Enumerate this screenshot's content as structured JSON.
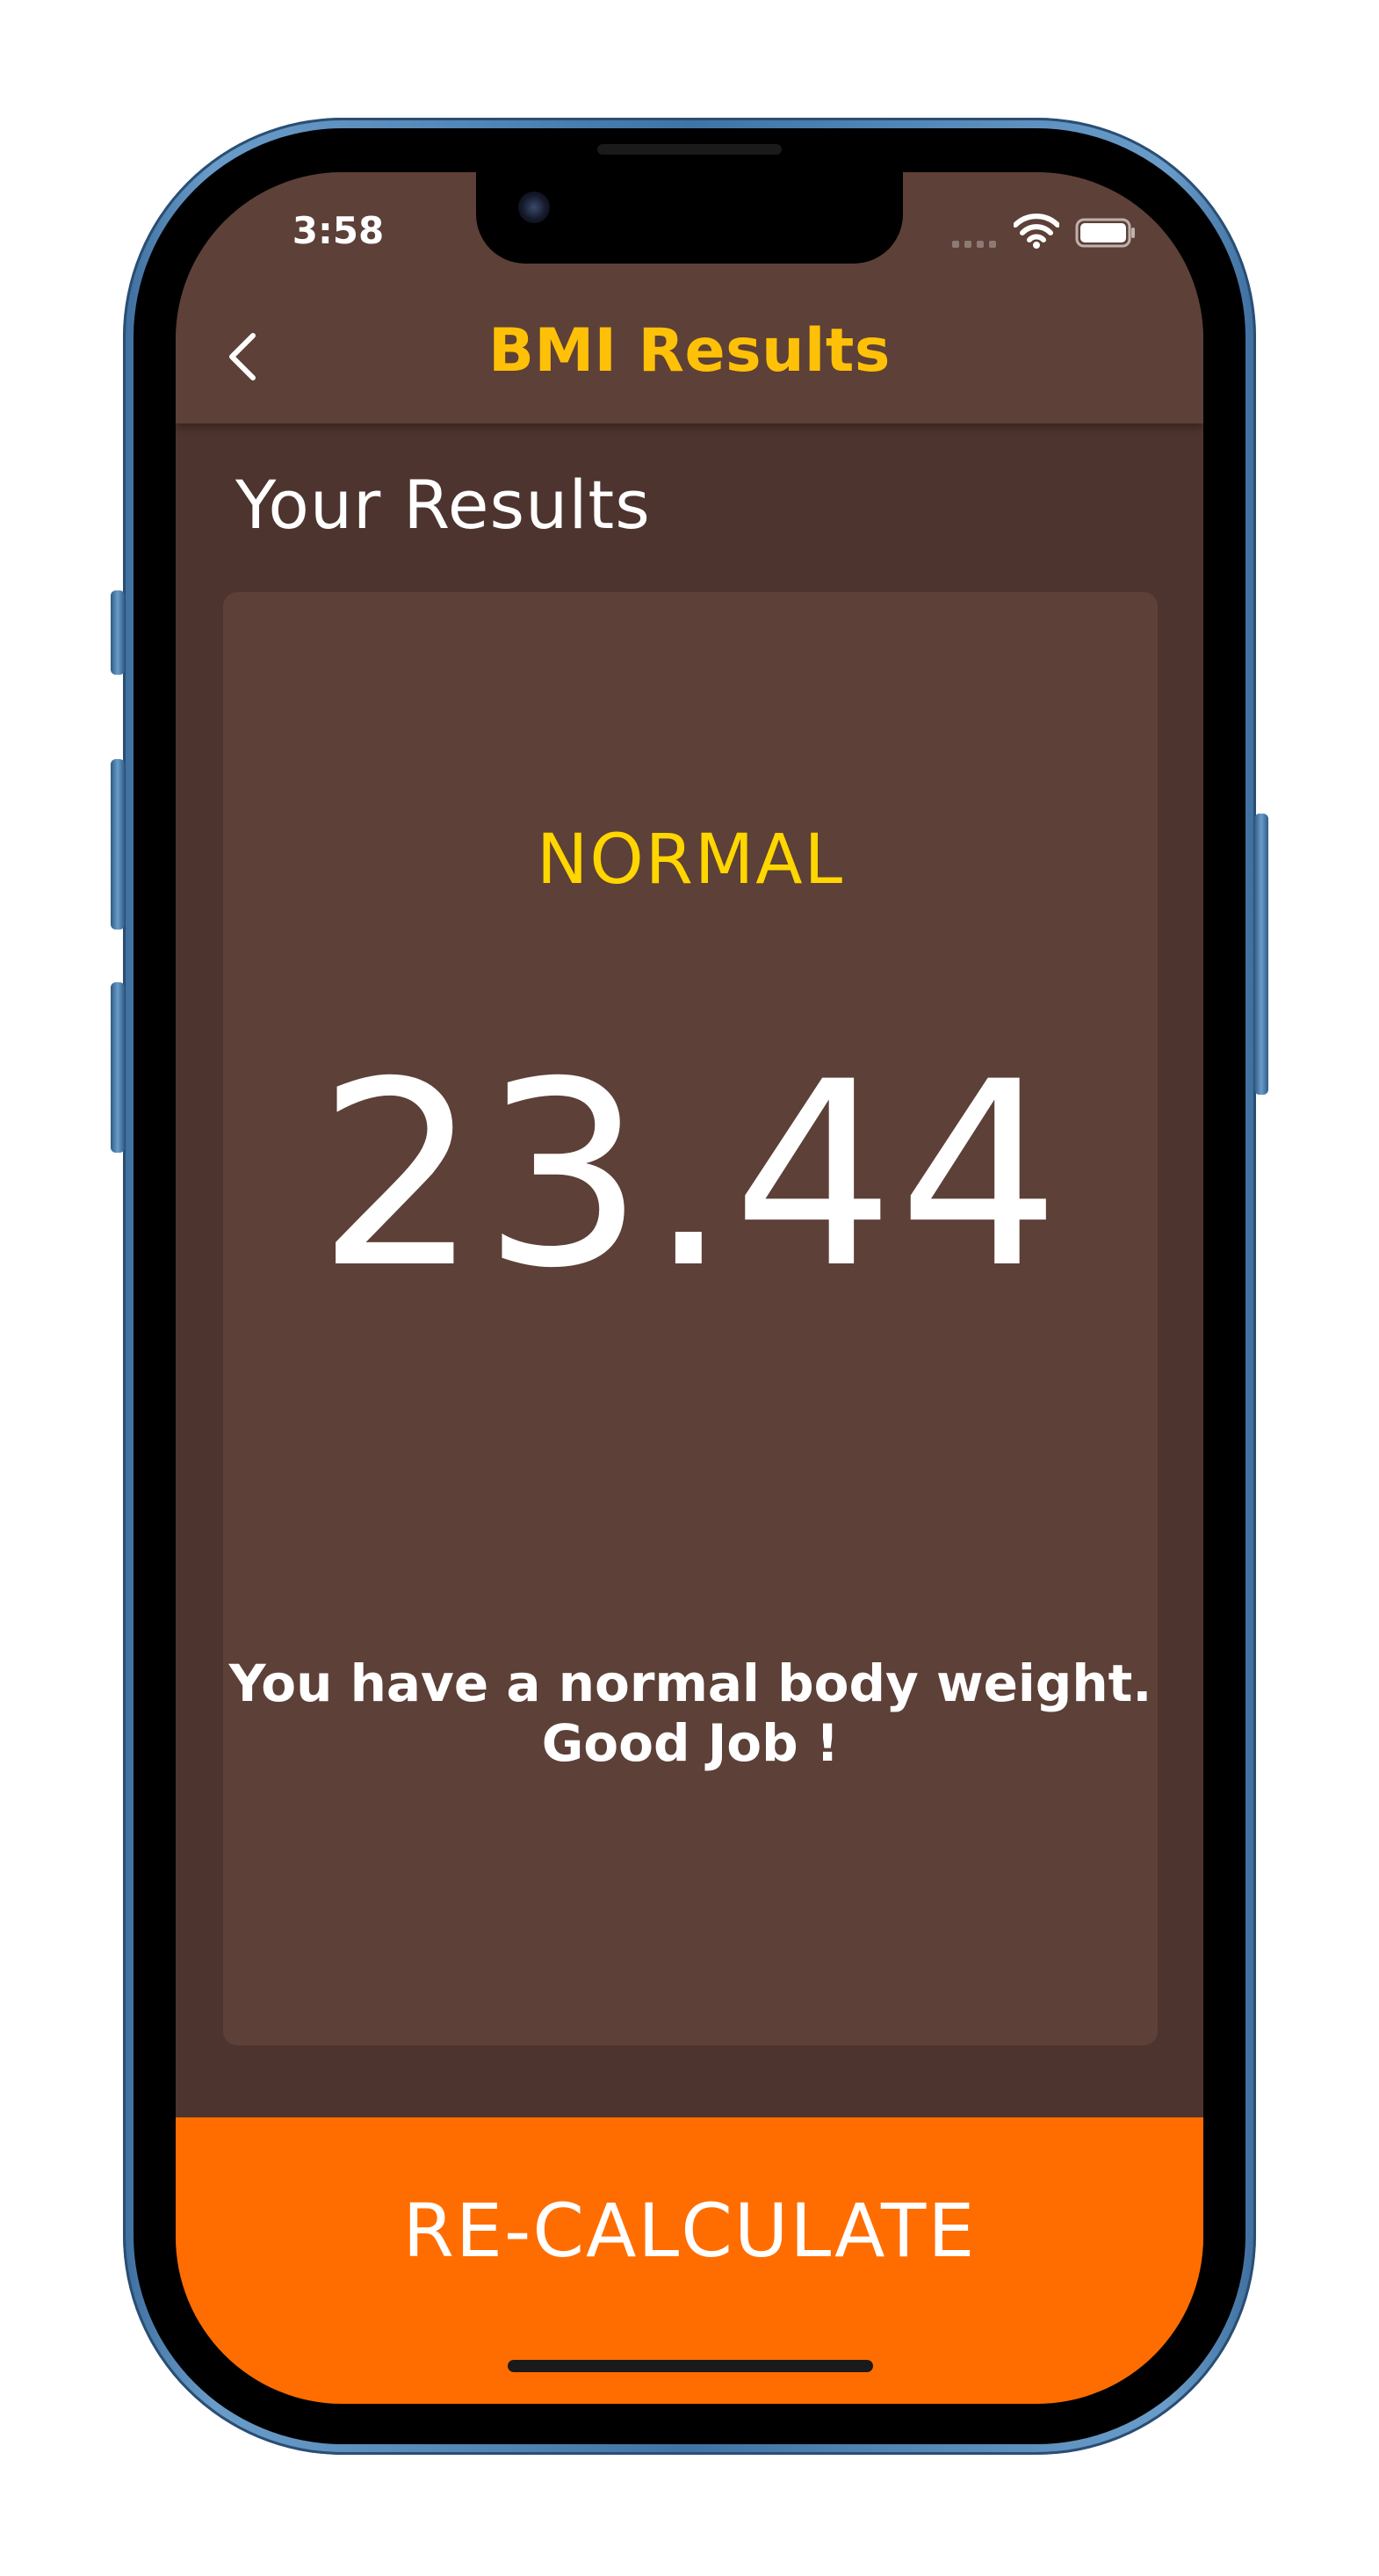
{
  "status_bar": {
    "time": "3:58",
    "icons": [
      "cellular-signal-icon",
      "wifi-icon",
      "battery-icon"
    ]
  },
  "app_bar": {
    "back_icon": "chevron-left-icon",
    "title": "BMI Results"
  },
  "main": {
    "section_title": "Your Results",
    "result": {
      "status": "NORMAL",
      "bmi": "23.44",
      "message_line1": "You have a normal body weight.",
      "message_line2": "Good Job !"
    }
  },
  "footer": {
    "recalculate_label": "RE-CALCULATE"
  },
  "colors": {
    "background": "#4e342e",
    "surface": "#5d4037",
    "title_accent": "#ffc107",
    "status_accent": "#ffd600",
    "button": "#ff6d00",
    "text": "#ffffff"
  }
}
